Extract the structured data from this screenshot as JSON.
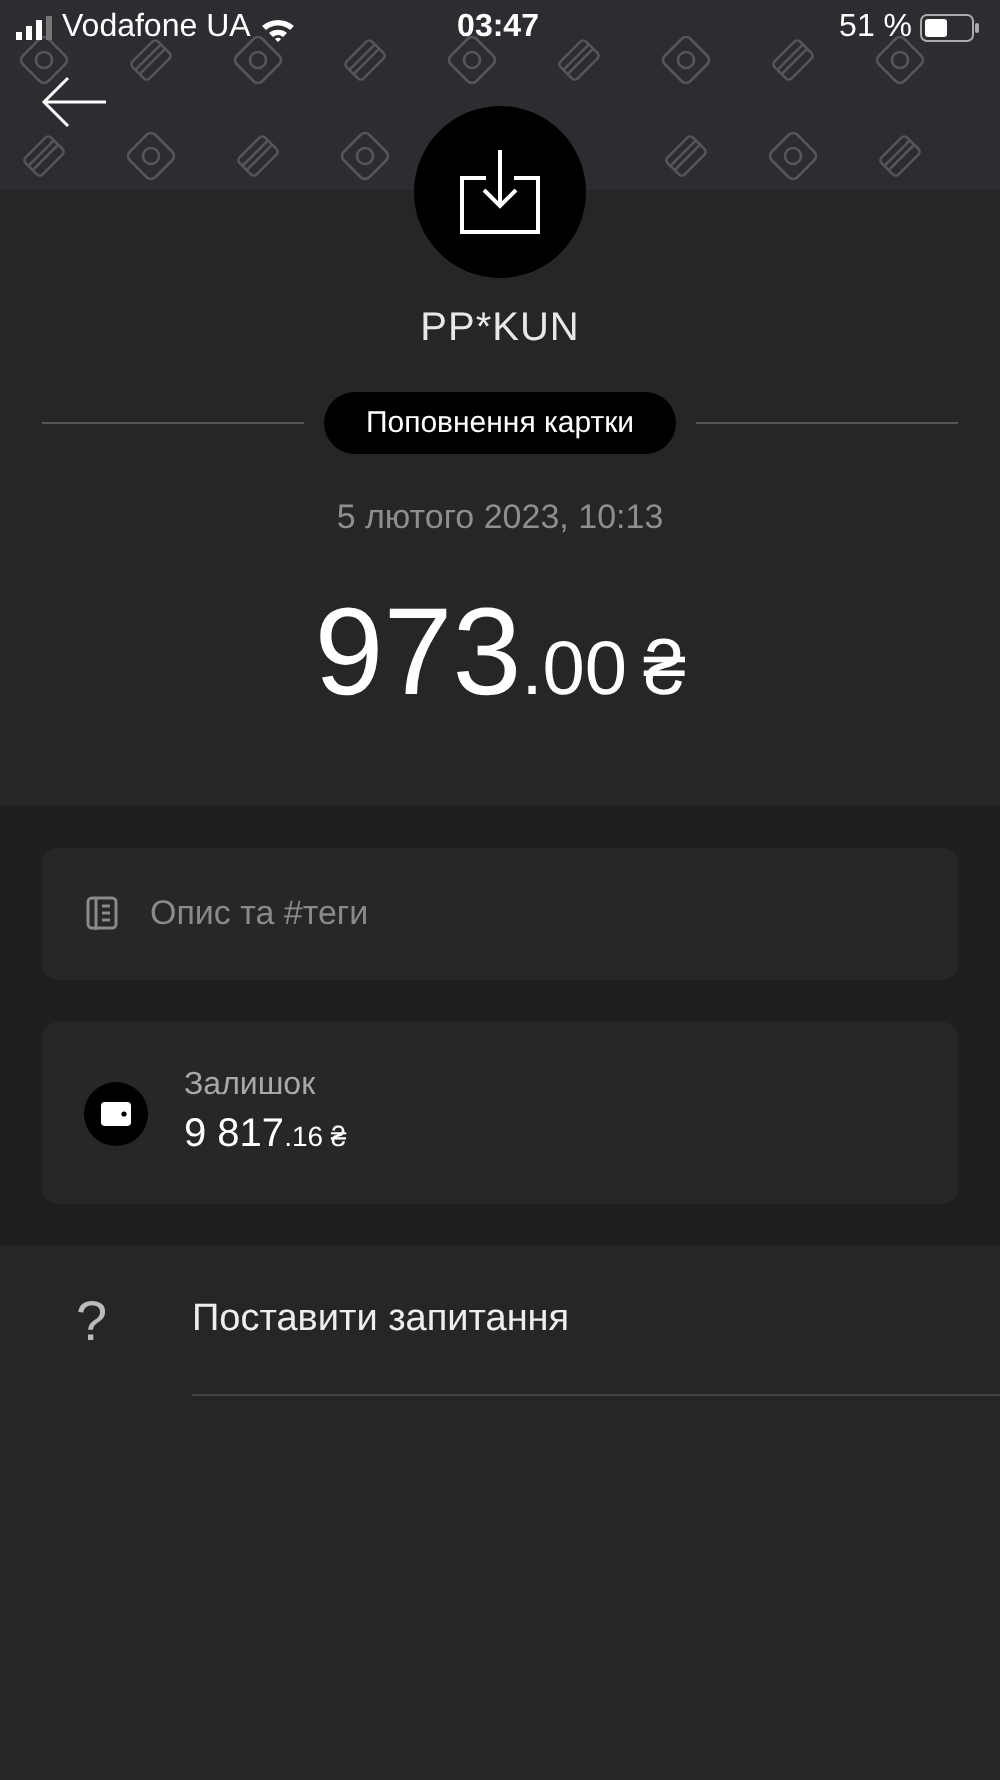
{
  "status_bar": {
    "carrier": "Vodafone UA",
    "time": "03:47",
    "battery": "51 %"
  },
  "transaction": {
    "merchant": "PP*KUN",
    "category": "Поповнення картки",
    "date": "5 лютого 2023, 10:13",
    "amount_integer": "973",
    "amount_fraction": ".00",
    "currency": "₴"
  },
  "description_field": {
    "placeholder": "Опис та #теги"
  },
  "balance": {
    "label": "Залишок",
    "amount_integer": "9 817",
    "amount_fraction": ".16",
    "currency": "₴"
  },
  "actions": [
    {
      "icon": "?",
      "label": "Поставити запитання"
    }
  ]
}
